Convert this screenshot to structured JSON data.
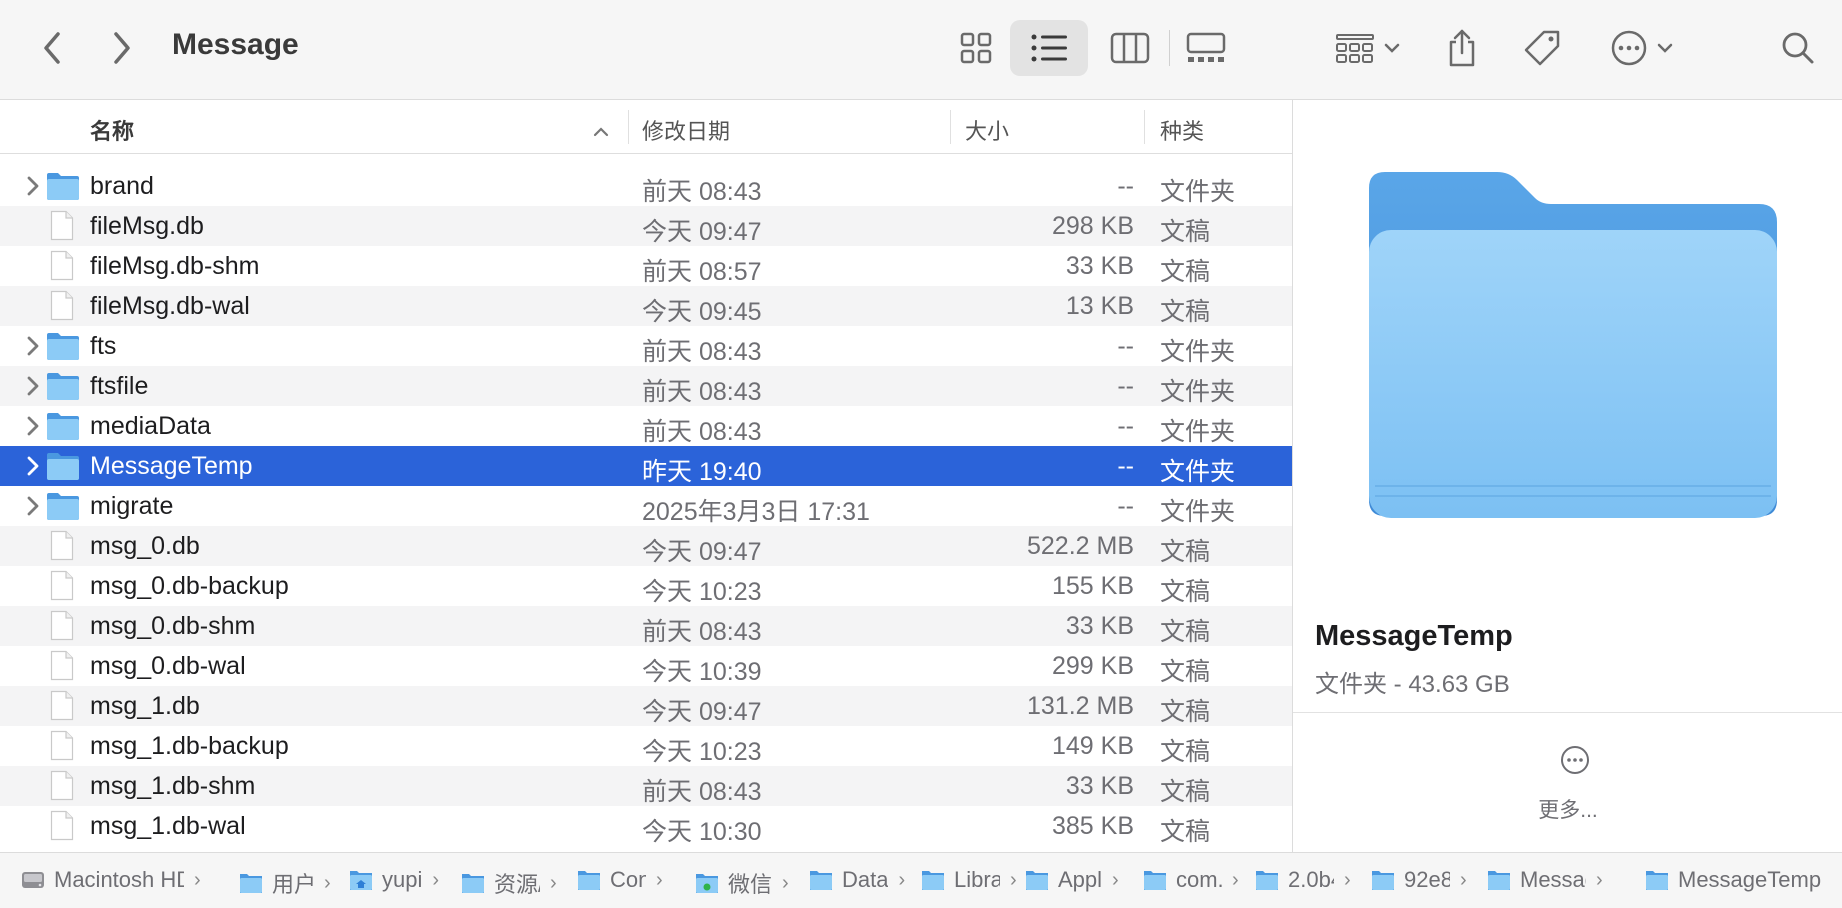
{
  "window": {
    "title": "Message"
  },
  "toolbar": {
    "icons": [
      "chevron-left-icon",
      "chevron-right-icon",
      "icon-view-icon",
      "list-view-icon",
      "column-view-icon",
      "gallery-view-icon",
      "group-icon",
      "share-icon",
      "tag-icon",
      "more-actions-icon",
      "search-icon"
    ],
    "active_view": "list"
  },
  "columns": {
    "name": "名称",
    "date": "修改日期",
    "size": "大小",
    "kind": "种类"
  },
  "rows": [
    {
      "name": "brand",
      "date": "前天 08:43",
      "size": "--",
      "kind": "文件夹",
      "type": "folder"
    },
    {
      "name": "fileMsg.db",
      "date": "今天 09:47",
      "size": "298 KB",
      "kind": "文稿",
      "type": "doc"
    },
    {
      "name": "fileMsg.db-shm",
      "date": "前天 08:57",
      "size": "33 KB",
      "kind": "文稿",
      "type": "doc"
    },
    {
      "name": "fileMsg.db-wal",
      "date": "今天 09:45",
      "size": "13 KB",
      "kind": "文稿",
      "type": "doc"
    },
    {
      "name": "fts",
      "date": "前天 08:43",
      "size": "--",
      "kind": "文件夹",
      "type": "folder"
    },
    {
      "name": "ftsfile",
      "date": "前天 08:43",
      "size": "--",
      "kind": "文件夹",
      "type": "folder"
    },
    {
      "name": "mediaData",
      "date": "前天 08:43",
      "size": "--",
      "kind": "文件夹",
      "type": "folder"
    },
    {
      "name": "MessageTemp",
      "date": "昨天 19:40",
      "size": "--",
      "kind": "文件夹",
      "type": "folder",
      "selected": true
    },
    {
      "name": "migrate",
      "date": "2025年3月3日 17:31",
      "size": "--",
      "kind": "文件夹",
      "type": "folder"
    },
    {
      "name": "msg_0.db",
      "date": "今天 09:47",
      "size": "522.2 MB",
      "kind": "文稿",
      "type": "doc"
    },
    {
      "name": "msg_0.db-backup",
      "date": "今天 10:23",
      "size": "155 KB",
      "kind": "文稿",
      "type": "doc"
    },
    {
      "name": "msg_0.db-shm",
      "date": "前天 08:43",
      "size": "33 KB",
      "kind": "文稿",
      "type": "doc"
    },
    {
      "name": "msg_0.db-wal",
      "date": "今天 10:39",
      "size": "299 KB",
      "kind": "文稿",
      "type": "doc"
    },
    {
      "name": "msg_1.db",
      "date": "今天 09:47",
      "size": "131.2 MB",
      "kind": "文稿",
      "type": "doc"
    },
    {
      "name": "msg_1.db-backup",
      "date": "今天 10:23",
      "size": "149 KB",
      "kind": "文稿",
      "type": "doc"
    },
    {
      "name": "msg_1.db-shm",
      "date": "前天 08:43",
      "size": "33 KB",
      "kind": "文稿",
      "type": "doc"
    },
    {
      "name": "msg_1.db-wal",
      "date": "今天 10:30",
      "size": "385 KB",
      "kind": "文稿",
      "type": "doc"
    }
  ],
  "preview": {
    "name": "MessageTemp",
    "info": "文件夹 - 43.63 GB",
    "more_label": "更多..."
  },
  "pathbar": [
    {
      "label": "Macintosh HD",
      "icon": "disk-icon"
    },
    {
      "label": "用户",
      "icon": "folder-icon"
    },
    {
      "label": "yupi",
      "icon": "home-folder-icon"
    },
    {
      "label": "资源/",
      "icon": "folder-icon"
    },
    {
      "label": "Cont",
      "icon": "folder-icon"
    },
    {
      "label": "微信",
      "icon": "app-folder-icon"
    },
    {
      "label": "Data",
      "icon": "folder-icon"
    },
    {
      "label": "Libra",
      "icon": "folder-icon"
    },
    {
      "label": "Appl",
      "icon": "folder-icon"
    },
    {
      "label": "com.",
      "icon": "folder-icon"
    },
    {
      "label": "2.0b4",
      "icon": "folder-icon"
    },
    {
      "label": "92e8",
      "icon": "folder-icon"
    },
    {
      "label": "Message",
      "icon": "folder-icon"
    },
    {
      "label": "MessageTemp",
      "icon": "folder-icon"
    }
  ],
  "colors": {
    "selection": "#2b63d9",
    "folder_light": "#8ccbf6",
    "folder_dark": "#4a98e0",
    "alt_row": "#f4f4f5"
  }
}
